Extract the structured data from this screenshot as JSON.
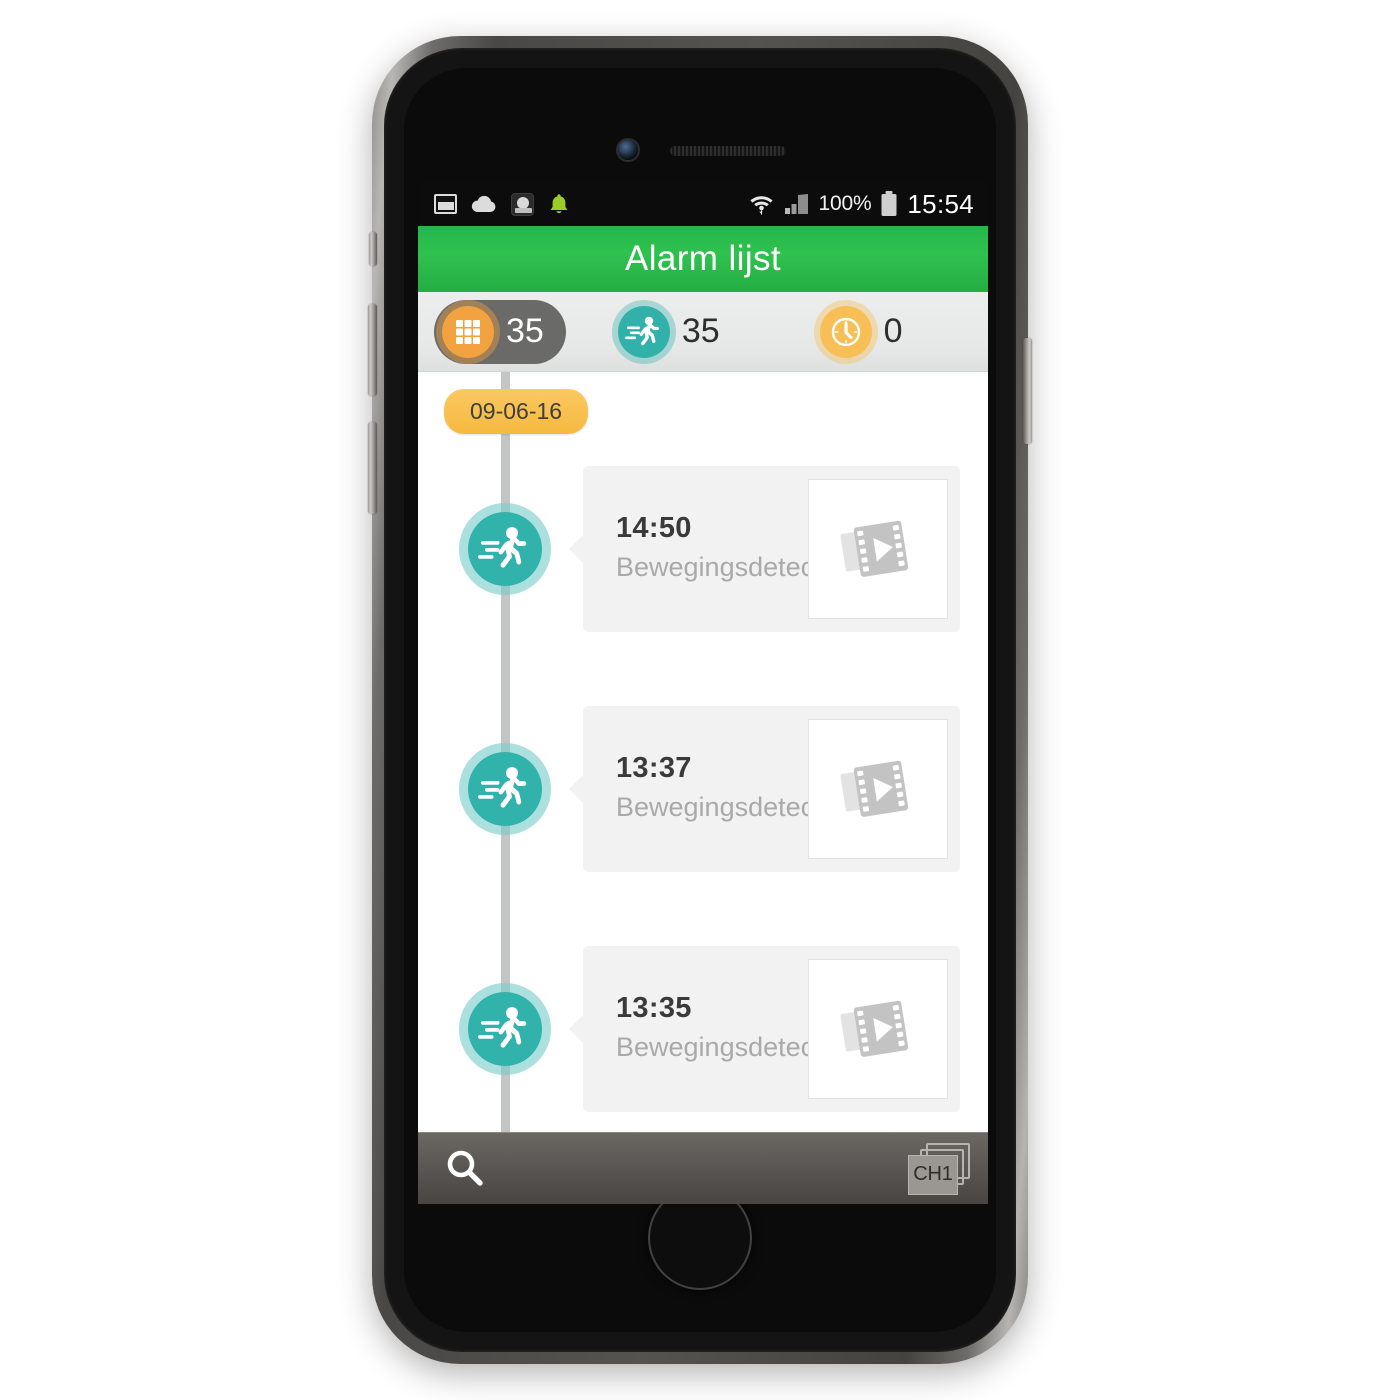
{
  "statusbar": {
    "icons": [
      "gallery-icon",
      "cloud-upload-icon",
      "alecto-app-icon",
      "bell-icon"
    ],
    "battery_percent": "100%",
    "clock": "15:54"
  },
  "titlebar": {
    "title": "Alarm lijst",
    "color": "#2fc24f"
  },
  "tabs": [
    {
      "name": "all",
      "icon": "grid-icon",
      "count": "35",
      "selected": true,
      "color": "#f2a33f"
    },
    {
      "name": "motion",
      "icon": "running-person-icon",
      "count": "35",
      "selected": false,
      "color": "#32b1aa"
    },
    {
      "name": "schedule",
      "icon": "clock-icon",
      "count": "0",
      "selected": false,
      "color": "#f7bf55"
    }
  ],
  "list": {
    "date_label": "09-06-16",
    "events": [
      {
        "time": "14:50",
        "label": "Bewegingsdetectie",
        "icon": "running-person-icon",
        "thumb": "video-clip-icon"
      },
      {
        "time": "13:37",
        "label": "Bewegingsdetectie",
        "icon": "running-person-icon",
        "thumb": "video-clip-icon"
      },
      {
        "time": "13:35",
        "label": "Bewegingsdetectie",
        "icon": "running-person-icon",
        "thumb": "video-clip-icon"
      }
    ]
  },
  "bottombar": {
    "search_label": "search-icon",
    "channel_label": "CH1"
  }
}
